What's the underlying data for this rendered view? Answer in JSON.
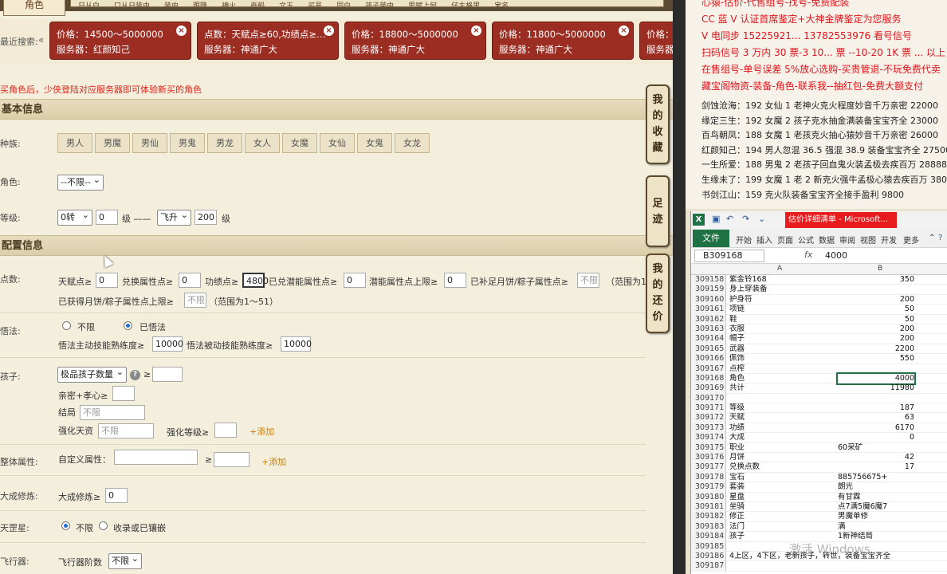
{
  "nav": {
    "main_tab": "角色",
    "items": [
      "日从白",
      "口从日装由",
      "装由",
      "跟降",
      "神火",
      "画船",
      "文玉",
      "买号",
      "同白",
      "孩子装由",
      "思赋上何",
      "仔主格里",
      "宝名"
    ]
  },
  "search": {
    "label": "最近搜索:",
    "chips": [
      {
        "line1": "价格：14500～5000000",
        "line2": "服务器：红颜知己"
      },
      {
        "line1": "点数：天赋点≥60,功绩点≥…",
        "line2": "服务器：神通广大"
      },
      {
        "line1": "价格：18800～5000000",
        "line2": "服务器：神通广大"
      },
      {
        "line1": "价格：11800～5000000",
        "line2": "服务器：神通广大"
      },
      {
        "line1": "价格：",
        "line2": "服务器"
      }
    ]
  },
  "notice": "买角色后，少侠登陆对应服务器即可体验新买的角色",
  "sections": {
    "basic": "基本信息",
    "config": "配置信息"
  },
  "form": {
    "race_label": "种族:",
    "races": [
      "男人",
      "男魔",
      "男仙",
      "男鬼",
      "男龙",
      "女人",
      "女魔",
      "女仙",
      "女鬼",
      "女龙"
    ],
    "role_label": "角色:",
    "role_value": "--不限--",
    "level_label": "等级:",
    "level_zhuan": "0转",
    "level_min": "0",
    "level_unit1": "级 ——",
    "level_feisheng": "飞升",
    "level_max": "200",
    "level_unit2": "级",
    "points_label": "点数:",
    "points": {
      "tianfu": "天赋点≥",
      "tianfu_val": "0",
      "duihuan": "兑换属性点≥",
      "duihuan_val": "0",
      "gongji": "功绩点≥",
      "gongji_val": "4800",
      "qianneng": "已兑潜能属性点≥",
      "qianneng_val": "0",
      "qianneng_max": "潜能属性点上限≥",
      "qianneng_max_val": "0",
      "yuebing": "已补足月饼/粽子属性点≥",
      "yuebing_ph": "不限",
      "range1": "（范围为1",
      "yuebing_max": "已获得月饼/粽子属性点上限≥",
      "yuebing_max_ph": "不限",
      "range2": "（范围为1～51）"
    },
    "wufa_label": "悟法:",
    "wufa_opt1": "不限",
    "wufa_opt2": "已悟法",
    "wufa_active": "悟法主动技能熟练度≥",
    "wufa_active_val": "10000",
    "wufa_passive": "悟法被动技能熟练度≥",
    "wufa_passive_val": "10000",
    "child_label": "孩子:",
    "child_select": "极品孩子数量",
    "child_intimacy": "亲密+孝心≥",
    "child_ending": "结局",
    "child_ending_ph": "不限",
    "child_strengthen": "强化天资",
    "child_strengthen_ph": "不限",
    "child_level": "强化等级≥",
    "child_add": "+添加",
    "overall_label": "整体属性:",
    "overall_custom": "自定义属性：",
    "overall_ge": "≥",
    "overall_add": "+添加",
    "dacheng_label": "大成修炼:",
    "dacheng_field": "大成修炼≥",
    "dacheng_val": "0",
    "tianzhao_label": "天罡星:",
    "tianzhao_opt1": "不限",
    "tianzhao_opt2": "收录或已镶嵌",
    "flyer_label": "飞行器:",
    "flyer_field": "飞行器阶数",
    "flyer_val": "不限"
  },
  "side_tabs": [
    {
      "label": "我的收藏"
    },
    {
      "label": "足迹"
    },
    {
      "label": "我的还价"
    }
  ],
  "right_panel": {
    "lines_red": [
      "心猿-估价-代售组号-找号-免费配装",
      "CC 蓝 V 认证首席鉴定+大神金牌鉴定为您服务",
      "V 电同步 15225921... 13782553976 看号信号",
      "扫码信号 3 万内 30 票-3 10... 票 --10-20 1K 票 ... 以上 150",
      "在售组号-单号误差 5%放心选购-买贵管退-不玩免费代卖",
      "藏宝阁物资-装备-角色-联系我--抽红包-免费大额支付"
    ],
    "lines_black": [
      "剑蚀沧海：192 女仙 1 老神火克火程度妙音千万亲密 22000",
      "缘定三生：192 女魔 2 孩子克水抽金满装备宝宝齐全 23000",
      "百鸟朝凤：188 女魔 1 老孩克火抽心猿妙音千万亲密 26000",
      "红颜知己：194 男人忽混 36.5 强混 38.9 装备宝宝齐全 27500",
      "一生所爱：188 男鬼 2 老孩子回血鬼火装孟极去疾百万 28888",
      "生缘未了：199 女魔 1 老 2 新克火强牛孟极心猿去疾百万 380",
      "书剑江山：159 克火队装备宝宝齐全接手盈利 9800"
    ]
  },
  "excel": {
    "icon": "X",
    "doc_title": "估价详细清单 - Microsoft...",
    "file_tab": "文件",
    "ribbon": [
      "开始",
      "插入",
      "页面",
      "公式",
      "数据",
      "审阅",
      "视图",
      "开发",
      "更多"
    ],
    "name_box": "B309168",
    "fx": "fx",
    "formula_value": "4000",
    "col_a": "A",
    "col_b": "B",
    "rows": [
      {
        "n": "309158",
        "a": "紫金铃168",
        "b": "350",
        "num": true
      },
      {
        "n": "309159",
        "a": "身上穿装备",
        "b": "",
        "num": false
      },
      {
        "n": "309160",
        "a": "护身符",
        "b": "200",
        "num": true
      },
      {
        "n": "309161",
        "a": "项链",
        "b": "50",
        "num": true
      },
      {
        "n": "309162",
        "a": "鞋",
        "b": "50",
        "num": true
      },
      {
        "n": "309163",
        "a": "衣服",
        "b": "200",
        "num": true
      },
      {
        "n": "309164",
        "a": "帽子",
        "b": "200",
        "num": true
      },
      {
        "n": "309165",
        "a": "武器",
        "b": "2200",
        "num": true
      },
      {
        "n": "309166",
        "a": "佩饰",
        "b": "550",
        "num": true
      },
      {
        "n": "309167",
        "a": "点榨",
        "b": "",
        "num": false
      },
      {
        "n": "309168",
        "a": "角色",
        "b": "4000",
        "num": true
      },
      {
        "n": "309169",
        "a": "共计",
        "b": "11980",
        "num": true
      },
      {
        "n": "309170",
        "a": "",
        "b": "",
        "num": false
      },
      {
        "n": "309171",
        "a": "等级",
        "b": "187",
        "num": true
      },
      {
        "n": "309172",
        "a": "天赋",
        "b": "63",
        "num": true
      },
      {
        "n": "309173",
        "a": "功绩",
        "b": "6170",
        "num": true
      },
      {
        "n": "309174",
        "a": "大成",
        "b": "0",
        "num": true
      },
      {
        "n": "309175",
        "a": "职业",
        "b": "60采矿",
        "num": false
      },
      {
        "n": "309176",
        "a": "月饼",
        "b": "42",
        "num": true
      },
      {
        "n": "309177",
        "a": "兑换点数",
        "b": "17",
        "num": true
      },
      {
        "n": "309178",
        "a": "宝石",
        "b": "885756675+",
        "num": false
      },
      {
        "n": "309179",
        "a": "套装",
        "b": "朗光",
        "num": false
      },
      {
        "n": "309180",
        "a": "星盘",
        "b": "有甘霖",
        "num": false
      },
      {
        "n": "309181",
        "a": "坐骑",
        "b": "点7满5魔6魔7",
        "num": false
      },
      {
        "n": "309182",
        "a": "修正",
        "b": "男魔单修",
        "num": false
      },
      {
        "n": "309183",
        "a": "法门",
        "b": "满",
        "num": false
      },
      {
        "n": "309184",
        "a": "孩子",
        "b": "1新神结局",
        "num": false
      },
      {
        "n": "309185",
        "a": "",
        "b": "",
        "num": false
      },
      {
        "n": "309186",
        "a": "4上区，4下区，老新孩子，转世，装备宝宝齐全",
        "b": "",
        "num": false
      },
      {
        "n": "309187",
        "a": "",
        "b": "",
        "num": false
      }
    ]
  },
  "watermark": "激活 Windows"
}
